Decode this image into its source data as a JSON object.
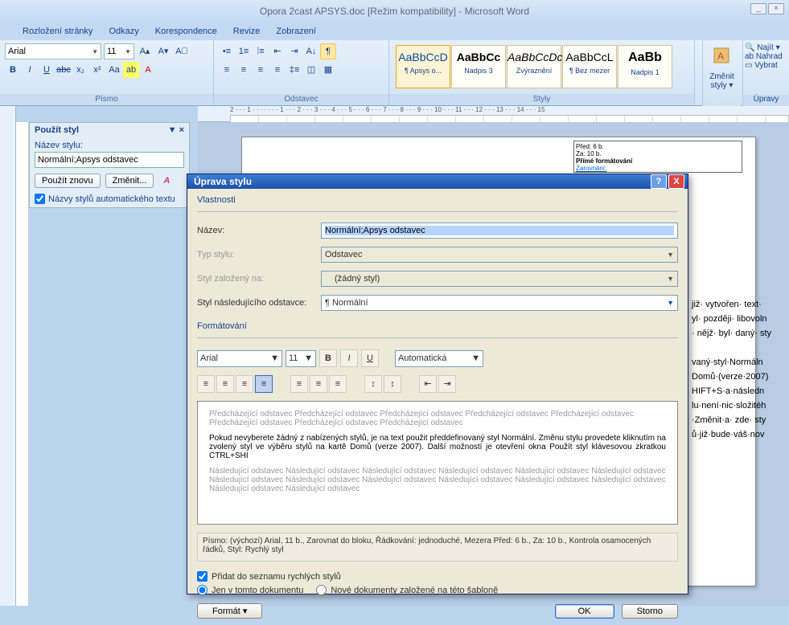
{
  "title": "Opora 2cast APSYS.doc [Režim kompatibility] - Microsoft Word",
  "tabs": [
    "Rozložení stránky",
    "Odkazy",
    "Korespondence",
    "Revize",
    "Zobrazení"
  ],
  "font_group": {
    "name": "Arial",
    "size": "11",
    "label": "Písmo"
  },
  "para_group": {
    "label": "Odstavec"
  },
  "styles_group": {
    "label": "Styly",
    "items": [
      {
        "sample": "AaBbCcD",
        "label": "¶ Apsys o...",
        "sample_style": "color:#004b9b",
        "sel": true
      },
      {
        "sample": "AaBbCc",
        "label": "Nadpis 3",
        "sample_style": "font-weight:bold"
      },
      {
        "sample": "AaBbCcDc",
        "label": "Zvýraznění",
        "sample_style": "font-style:italic"
      },
      {
        "sample": "AaBbCcL",
        "label": "¶ Bez mezer",
        "sample_style": ""
      },
      {
        "sample": "AaBb",
        "label": "Nadpis 1",
        "sample_style": "font-weight:bold;font-size:16px"
      }
    ],
    "change": "Změnit styly ▾"
  },
  "editing_group": {
    "label": "Úpravy",
    "find": "Najít ▾",
    "replace": "Nahrad",
    "select": "Vybrat"
  },
  "task_pane": {
    "title": "Použít styl",
    "label": "Název stylu:",
    "value": "Normální;Apsys odstavec",
    "reapply": "Použít znovu",
    "change": "Změnit...",
    "auto": "Názvy stylů automatického textu"
  },
  "page_tip": {
    "l1": "Před: 6 b.",
    "l2": "Za: 10 b.",
    "l3": "Přímé formátování",
    "l4": "Zarovnání:"
  },
  "doc_frag": [
    "již· vytvořen· text· ",
    "yl· později· libovoln",
    "· nějž· byl· daný· sty",
    "",
    "vaný·styl·Normáln",
    "Domů·(verze·2007)",
    "HIFT+S·a·následn",
    "lu·není·nic·složitéh",
    "·Změnit·a· zde· sty",
    "ů·již·bude·váš·nov"
  ],
  "dialog": {
    "title": "Úprava stylu",
    "vlastnosti": "Vlastnosti",
    "name_lbl": "Název:",
    "name_val": "Normální;Apsys odstavec",
    "type_lbl": "Typ stylu:",
    "type_val": "Odstavec",
    "based_lbl": "Styl založený na:",
    "based_val": "(žádný styl)",
    "next_lbl": "Styl následujícího odstavce:",
    "next_val": "¶ Normální",
    "formatting": "Formátování",
    "font": "Arial",
    "size": "11",
    "color": "Automatická",
    "prev_before": "Předcházející odstavec Předcházející odstavec Předcházející odstavec Předcházející odstavec Předcházející odstavec Předcházející odstavec Předcházející odstavec Předcházející odstavec",
    "prev_main": "Pokud nevyberete žádný z nabízených stylů, je na text použit předdefinovaný styl Normální. Změnu stylu provedete kliknutím na zvolený styl ve výběru stylů na kartě Domů (verze 2007). Další možností je otevření okna Použít styl klávesovou zkratkou CTRL+SHI",
    "prev_after": "Následující odstavec Následující odstavec Následující odstavec Následující odstavec Následující odstavec Následující odstavec Následující odstavec Následující odstavec Následující odstavec Následující odstavec Následující odstavec Následující odstavec Následující odstavec Následující odstavec",
    "desc": "Písmo: (výchozí) Arial, 11 b., Zarovnat do bloku, Řádkování:  jednoduché, Mezera Před:  6 b., Za:  10 b., Kontrola osamocených řádků, Styl: Rychlý styl",
    "quick": "Přidat do seznamu rychlých stylů",
    "r1": "Jen v tomto dokumentu",
    "r2": "Nové dokumenty založené na této šabloně",
    "format": "Formát ▾",
    "ok": "OK",
    "cancel": "Storno"
  }
}
